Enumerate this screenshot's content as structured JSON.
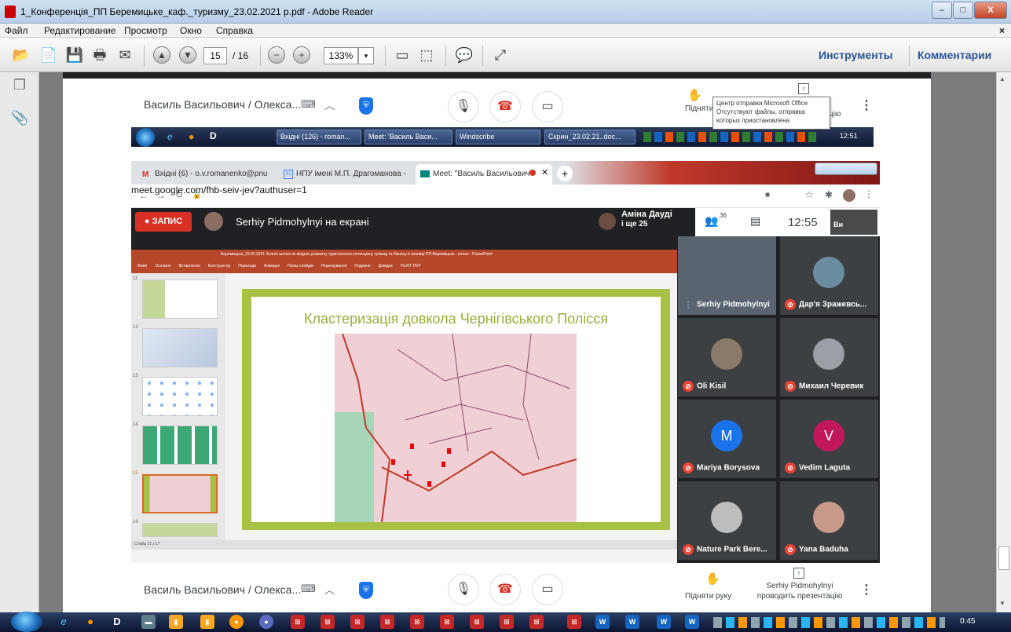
{
  "window": {
    "title": "1_Конференція_ПП Беремицьке_каф._туризму_23.02.2021 р.pdf - Adobe Reader",
    "min_label": "–",
    "max_label": "□",
    "close_label": "X",
    "menu_close": "×"
  },
  "menu": [
    "Файл",
    "Редактирование",
    "Просмотр",
    "Окно",
    "Справка"
  ],
  "toolbar": {
    "page_current": "15",
    "page_total": "/ 16",
    "zoom": "133%",
    "tools_label": "Инструменты",
    "comments_label": "Комментарии"
  },
  "meet_top": {
    "presenter": "Василь Васильович / Олекса...",
    "raise_hand": "Підняти",
    "presenting_suffix": "цію"
  },
  "tooltip": {
    "title": "Центр отправки Microsoft Office",
    "body": "Отсутствуют файлы, отправка которых приостановлена"
  },
  "inner_taskbar": {
    "items": [
      "Вхідні (126) - roman...",
      "Meet: 'Василь Васи...",
      "Windscribe",
      "Скрин_23.02.21..doc..."
    ],
    "clock": "12:51"
  },
  "chrome": {
    "tabs": [
      "Вхідні (6) - o.v.romanenko@pnu",
      "НПУ імені М.П. Драгоманова -",
      "Meet: \"Василь Васильович"
    ],
    "url": "meet.google.com/fhb-seiv-jev?authuser=1"
  },
  "meet": {
    "recording_label": "ЗАПИС",
    "screen_share_text": "Serhiy Pidmohylnyi на екрані",
    "speaker_name": "Аміна Дауді",
    "speaker_more": "і ще 25",
    "participants_count": "36",
    "time": "12:55",
    "you_label": "Ви"
  },
  "ppt": {
    "title_bar": "Беремицьке_23.02.2021 Зелені шляхи як модель розвитку туристичного потенціалу громад та бізнесу в окопиці ПП Беремицьке - колон · PowerPoint",
    "ribbon": [
      "Файл",
      "Основне",
      "Вставлення",
      "Конструктор",
      "Переходи",
      "Анімація",
      "Показ слайдів",
      "Рецензування",
      "Подання",
      "Довідка",
      "FOXIT PDF"
    ],
    "thumb_numbers": [
      "11",
      "12",
      "13",
      "14",
      "15",
      "16"
    ],
    "slide_title": "Кластеризація довкола Чернігівського Полісся",
    "status": "Слайд 15 з 17"
  },
  "participants": [
    {
      "name": "Serhiy Pidmohylnyi",
      "muted": false,
      "avatar": "",
      "color": "#5a6470"
    },
    {
      "name": "Дар'я Зражевсь...",
      "muted": true,
      "avatar": "",
      "color": "#6a8da0"
    },
    {
      "name": "Oli Kisil",
      "muted": true,
      "avatar": "",
      "color": "#8b7a6a"
    },
    {
      "name": "Михаил Черевик",
      "muted": true,
      "avatar": "",
      "color": "#9aa0a6"
    },
    {
      "name": "Mariya Borysova",
      "muted": true,
      "avatar": "M",
      "color": "#1a73e8"
    },
    {
      "name": "Vedim Laguta",
      "muted": true,
      "avatar": "V",
      "color": "#c2185b"
    },
    {
      "name": "Nature Park Bere...",
      "muted": true,
      "avatar": "",
      "color": "#bdbdbd"
    },
    {
      "name": "Yana Baduha",
      "muted": true,
      "avatar": "",
      "color": "#c79a8a"
    }
  ],
  "meet_bottom": {
    "presenter": "Василь Васильович / Олекса...",
    "raise_hand": "Підняти руку",
    "presenting": "Serhiy Pidmohylnyi",
    "presenting2": "проводить презентацію"
  },
  "taskbar": {
    "clock": "0:45"
  }
}
